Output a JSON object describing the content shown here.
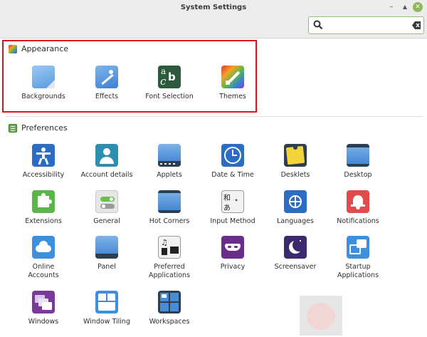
{
  "window": {
    "title": "System Settings",
    "search": {
      "value": "",
      "placeholder": ""
    },
    "accent": "#8fb65a"
  },
  "sections": {
    "appearance": {
      "title": "Appearance",
      "highlight_color": "#e0131a",
      "items": [
        {
          "label": "Backgrounds",
          "icon": "backgrounds-icon"
        },
        {
          "label": "Effects",
          "icon": "effects-icon"
        },
        {
          "label": "Font Selection",
          "icon": "font-selection-icon"
        },
        {
          "label": "Themes",
          "icon": "themes-icon"
        }
      ]
    },
    "preferences": {
      "title": "Preferences",
      "items": [
        {
          "label": "Accessibility",
          "icon": "accessibility-icon"
        },
        {
          "label": "Account details",
          "icon": "account-details-icon"
        },
        {
          "label": "Applets",
          "icon": "applets-icon"
        },
        {
          "label": "Date & Time",
          "icon": "date-time-icon"
        },
        {
          "label": "Desklets",
          "icon": "desklets-icon"
        },
        {
          "label": "Desktop",
          "icon": "desktop-icon"
        },
        {
          "label": "Extensions",
          "icon": "extensions-icon"
        },
        {
          "label": "General",
          "icon": "general-icon"
        },
        {
          "label": "Hot Corners",
          "icon": "hot-corners-icon"
        },
        {
          "label": "Input Method",
          "icon": "input-method-icon"
        },
        {
          "label": "Languages",
          "icon": "languages-icon"
        },
        {
          "label": "Notifications",
          "icon": "notifications-icon"
        },
        {
          "label": "Online\nAccounts",
          "icon": "online-accounts-icon"
        },
        {
          "label": "Panel",
          "icon": "panel-icon"
        },
        {
          "label": "Preferred\nApplications",
          "icon": "preferred-applications-icon"
        },
        {
          "label": "Privacy",
          "icon": "privacy-icon"
        },
        {
          "label": "Screensaver",
          "icon": "screensaver-icon"
        },
        {
          "label": "Startup\nApplications",
          "icon": "startup-applications-icon"
        },
        {
          "label": "Windows",
          "icon": "windows-icon"
        },
        {
          "label": "Window Tiling",
          "icon": "window-tiling-icon"
        },
        {
          "label": "Workspaces",
          "icon": "workspaces-icon"
        }
      ]
    }
  }
}
